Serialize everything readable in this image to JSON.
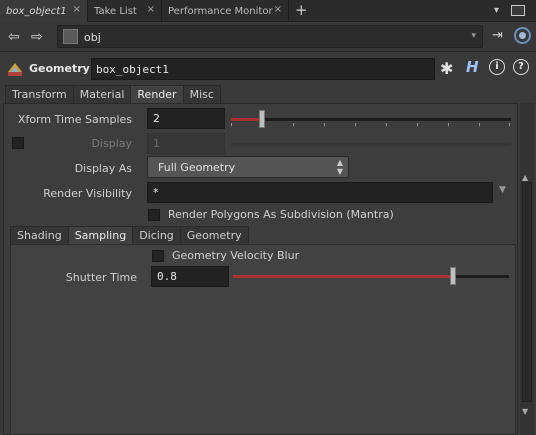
{
  "tabs": [
    {
      "label": "box_object1",
      "close": "×"
    },
    {
      "label": "Take List",
      "close": "×"
    },
    {
      "label": "Performance Monitor",
      "close": "×"
    }
  ],
  "tab_add": "+",
  "tab_menu": "▾",
  "nav": {
    "back": "⇦",
    "forward": "⇨",
    "path": "obj",
    "caret": "▾",
    "pin": "⇥"
  },
  "header": {
    "node_type": "Geometry",
    "node_name": "box_object1",
    "gear": "✱",
    "h": "H",
    "info": "i",
    "help": "?"
  },
  "param_tabs": [
    "Transform",
    "Material",
    "Render",
    "Misc"
  ],
  "params": {
    "xform_time_samples": {
      "label": "Xform Time Samples",
      "value": "2"
    },
    "display": {
      "label": "Display",
      "value": "1"
    },
    "display_as": {
      "label": "Display As",
      "value": "Full Geometry"
    },
    "render_visibility": {
      "label": "Render Visibility",
      "value": "*"
    },
    "render_polygons_subdivision": {
      "label": "Render Polygons As Subdivision (Mantra)"
    }
  },
  "sub_tabs": [
    "Shading",
    "Sampling",
    "Dicing",
    "Geometry"
  ],
  "sampling": {
    "geometry_velocity_blur": {
      "label": "Geometry Velocity Blur"
    },
    "shutter_time": {
      "label": "Shutter Time",
      "value": "0.8"
    }
  },
  "colors": {
    "accent": "#a83232",
    "panel": "#3d3d3d",
    "field": "#222222"
  }
}
